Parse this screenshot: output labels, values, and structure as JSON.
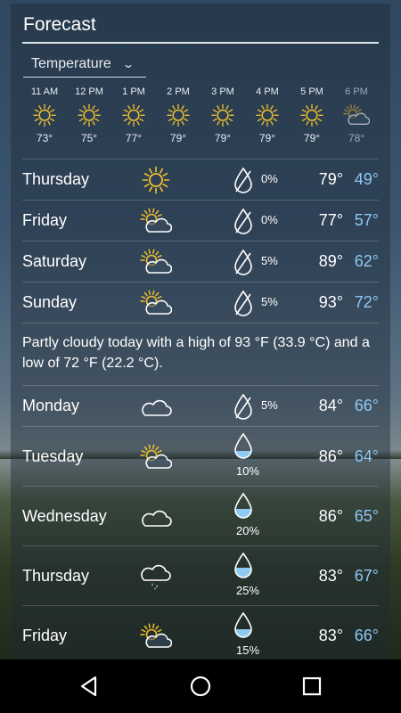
{
  "header": {
    "title": "Forecast"
  },
  "dropdown": {
    "selected": "Temperature"
  },
  "hourly": [
    {
      "time": "11 AM",
      "temp": "73°",
      "icon": "sun-icon"
    },
    {
      "time": "12 PM",
      "temp": "75°",
      "icon": "sun-icon"
    },
    {
      "time": "1 PM",
      "temp": "77°",
      "icon": "sun-icon"
    },
    {
      "time": "2 PM",
      "temp": "79°",
      "icon": "sun-icon"
    },
    {
      "time": "3 PM",
      "temp": "79°",
      "icon": "sun-icon"
    },
    {
      "time": "4 PM",
      "temp": "79°",
      "icon": "sun-icon"
    },
    {
      "time": "5 PM",
      "temp": "79°",
      "icon": "sun-icon"
    },
    {
      "time": "6 PM",
      "temp": "78°",
      "icon": "partly-cloudy-icon"
    }
  ],
  "daily": [
    {
      "day": "Thursday",
      "icon": "sun-icon",
      "precip": "0%",
      "precip_style": "side",
      "hi": "79°",
      "lo": "49°"
    },
    {
      "day": "Friday",
      "icon": "partly-cloudy-icon",
      "precip": "0%",
      "precip_style": "side",
      "hi": "77°",
      "lo": "57°"
    },
    {
      "day": "Saturday",
      "icon": "partly-cloudy-icon",
      "precip": "5%",
      "precip_style": "side",
      "hi": "89°",
      "lo": "62°"
    },
    {
      "day": "Sunday",
      "icon": "partly-cloudy-icon",
      "precip": "5%",
      "precip_style": "side",
      "hi": "93°",
      "lo": "72°"
    },
    {
      "summary": "Partly cloudy today with a high of 93 °F (33.9 °C) and a low of 72 °F (22.2 °C)."
    },
    {
      "day": "Monday",
      "icon": "cloud-icon",
      "precip": "5%",
      "precip_style": "side",
      "hi": "84°",
      "lo": "66°"
    },
    {
      "day": "Tuesday",
      "icon": "partly-cloudy-icon",
      "precip": "10%",
      "precip_style": "below",
      "hi": "86°",
      "lo": "64°"
    },
    {
      "day": "Wednesday",
      "icon": "cloud-icon",
      "precip": "20%",
      "precip_style": "below",
      "hi": "86°",
      "lo": "65°"
    },
    {
      "day": "Thursday",
      "icon": "rain-cloud-icon",
      "precip": "25%",
      "precip_style": "below",
      "hi": "83°",
      "lo": "67°"
    },
    {
      "day": "Friday",
      "icon": "partly-cloudy-icon",
      "precip": "15%",
      "precip_style": "below",
      "hi": "83°",
      "lo": "66°"
    }
  ],
  "colors": {
    "sun": "#f2c12e",
    "low_temp": "#8ec8f4",
    "drop_fill": "#8fcaf2"
  },
  "navbar": {
    "back_icon": "back-triangle-icon",
    "home_icon": "home-circle-icon",
    "recents_icon": "recents-square-icon"
  }
}
